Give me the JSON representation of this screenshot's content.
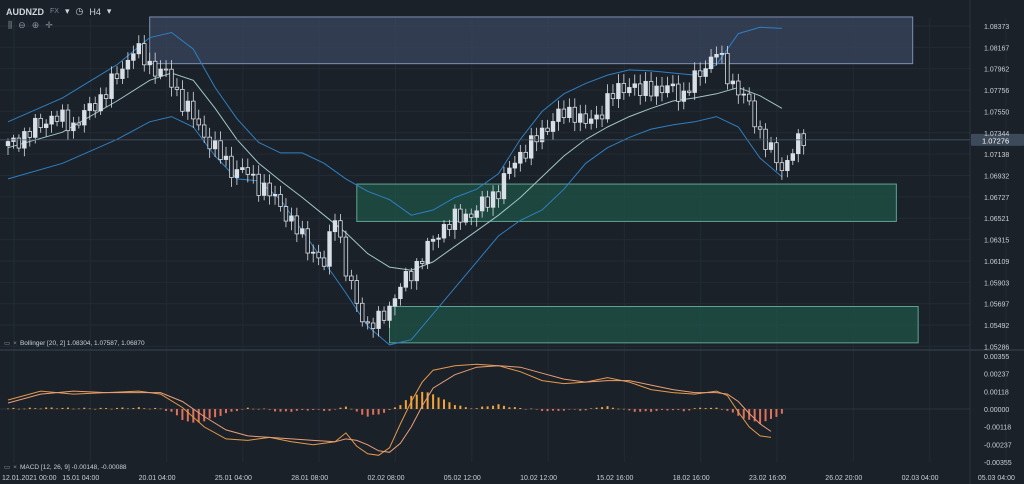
{
  "header": {
    "symbol": "AUDNZD",
    "symbol_type": "FX",
    "timeframe": "H4",
    "symbol_chevron_icon": "chevron-down-icon",
    "clock_icon": "clock-icon",
    "timeframe_chevron_icon": "chevron-down-icon"
  },
  "tools": [
    "bar-chart-icon",
    "zoom-out-icon",
    "zoom-in-icon",
    "crosshair-icon"
  ],
  "indicators": {
    "bollinger_label": "Bollinger [20, 2] 1.08304, 1.07587, 1.06870",
    "macd_label": "MACD [12, 26, 9] -0.00148, -0.00088"
  },
  "colors": {
    "background": "#1b2129",
    "bollinger_band": "#2f7fc1",
    "middle_band": "#9fc6c6",
    "candle_up": "#d9dfe6",
    "candle_down": "#d9dfe6",
    "supply_zone": "#3d4c66",
    "demand_zone": "#1f5a4c",
    "histogram_pos": "#f2a33a",
    "histogram_neg": "#e0705a",
    "macd_line": "#e49a4a",
    "signal_line": "#e89e78",
    "price_marker": "#3c4a5a"
  },
  "chart_data": [
    {
      "type": "candlestick",
      "symbol": "AUDNZD",
      "timeframe": "H4",
      "ylim": [
        1.0528,
        1.0845
      ],
      "y_ticks": [
        "1.08373",
        "1.08167",
        "1.07962",
        "1.07756",
        "1.07550",
        "1.07344",
        "1.07138",
        "1.06932",
        "1.06727",
        "1.06521",
        "1.06315",
        "1.06109",
        "1.05903",
        "1.05697",
        "1.05492",
        "1.05286"
      ],
      "current_price": "1.07276",
      "x_ticks": [
        "12.01.2021 00:00",
        "15.01 04:00",
        "20.01 04:00",
        "25.01 04:00",
        "28.01 08:00",
        "02.02 08:00",
        "05.02 12:00",
        "10.02 12:00",
        "15.02 16:00",
        "18.02 16:00",
        "23.02 16:00",
        "26.02 20:00",
        "02.03 04:00",
        "05.03 04:00"
      ],
      "close_path": [
        [
          0,
          1.0722
        ],
        [
          4,
          1.0735
        ],
        [
          8,
          1.075
        ],
        [
          12,
          1.0742
        ],
        [
          16,
          1.0762
        ],
        [
          20,
          1.0788
        ],
        [
          23,
          1.0815
        ],
        [
          26,
          1.08
        ],
        [
          29,
          1.079
        ],
        [
          32,
          1.0765
        ],
        [
          35,
          1.074
        ],
        [
          38,
          1.0718
        ],
        [
          41,
          1.07
        ],
        [
          44,
          1.0695
        ],
        [
          47,
          1.068
        ],
        [
          50,
          1.0665
        ],
        [
          53,
          1.064
        ],
        [
          56,
          1.062
        ],
        [
          58,
          1.0605
        ],
        [
          60,
          1.066
        ],
        [
          62,
          1.06
        ],
        [
          64,
          1.057
        ],
        [
          66,
          1.0548
        ],
        [
          68,
          1.0552
        ],
        [
          70,
          1.0568
        ],
        [
          72,
          1.0585
        ],
        [
          74,
          1.06
        ],
        [
          76,
          1.0615
        ],
        [
          78,
          1.063
        ],
        [
          80,
          1.0645
        ],
        [
          82,
          1.065
        ],
        [
          84,
          1.0655
        ],
        [
          86,
          1.066
        ],
        [
          88,
          1.0668
        ],
        [
          90,
          1.068
        ],
        [
          92,
          1.0698
        ],
        [
          94,
          1.0715
        ],
        [
          96,
          1.0722
        ],
        [
          98,
          1.0735
        ],
        [
          100,
          1.0748
        ],
        [
          102,
          1.0752
        ],
        [
          104,
          1.0755
        ],
        [
          106,
          1.0742
        ],
        [
          108,
          1.075
        ],
        [
          110,
          1.0765
        ],
        [
          112,
          1.0775
        ],
        [
          114,
          1.0782
        ],
        [
          116,
          1.0772
        ],
        [
          118,
          1.078
        ],
        [
          120,
          1.0774
        ],
        [
          122,
          1.0778
        ],
        [
          124,
          1.077
        ],
        [
          126,
          1.0785
        ],
        [
          128,
          1.08
        ],
        [
          130,
          1.0812
        ],
        [
          132,
          1.079
        ],
        [
          134,
          1.0775
        ],
        [
          136,
          1.076
        ],
        [
          138,
          1.0735
        ],
        [
          140,
          1.0715
        ],
        [
          142,
          1.07
        ],
        [
          144,
          1.0718
        ],
        [
          146,
          1.0728
        ]
      ],
      "bollinger": {
        "upper": [
          [
            0,
            1.0745
          ],
          [
            10,
            1.0768
          ],
          [
            20,
            1.08
          ],
          [
            26,
            1.0826
          ],
          [
            30,
            1.0831
          ],
          [
            34,
            1.0815
          ],
          [
            38,
            1.0778
          ],
          [
            42,
            1.0748
          ],
          [
            46,
            1.0725
          ],
          [
            50,
            1.0715
          ],
          [
            54,
            1.0715
          ],
          [
            58,
            1.0705
          ],
          [
            62,
            1.069
          ],
          [
            66,
            1.0678
          ],
          [
            70,
            1.067
          ],
          [
            74,
            1.0655
          ],
          [
            78,
            1.066
          ],
          [
            82,
            1.0672
          ],
          [
            86,
            1.068
          ],
          [
            90,
            1.0695
          ],
          [
            94,
            1.0728
          ],
          [
            98,
            1.0755
          ],
          [
            102,
            1.0772
          ],
          [
            106,
            1.0782
          ],
          [
            110,
            1.079
          ],
          [
            114,
            1.0795
          ],
          [
            118,
            1.0794
          ],
          [
            122,
            1.0792
          ],
          [
            126,
            1.079
          ],
          [
            130,
            1.08
          ],
          [
            134,
            1.083
          ],
          [
            138,
            1.0836
          ],
          [
            142,
            1.0835
          ]
        ],
        "middle": [
          [
            0,
            1.072
          ],
          [
            10,
            1.0735
          ],
          [
            20,
            1.0765
          ],
          [
            26,
            1.0785
          ],
          [
            30,
            1.0792
          ],
          [
            34,
            1.0785
          ],
          [
            38,
            1.0758
          ],
          [
            42,
            1.0728
          ],
          [
            46,
            1.0705
          ],
          [
            50,
            1.0688
          ],
          [
            54,
            1.0672
          ],
          [
            58,
            1.0655
          ],
          [
            62,
            1.0638
          ],
          [
            66,
            1.0618
          ],
          [
            70,
            1.0605
          ],
          [
            74,
            1.0602
          ],
          [
            78,
            1.061
          ],
          [
            82,
            1.0625
          ],
          [
            86,
            1.064
          ],
          [
            90,
            1.0655
          ],
          [
            94,
            1.0672
          ],
          [
            98,
            1.0692
          ],
          [
            102,
            1.0712
          ],
          [
            106,
            1.0728
          ],
          [
            110,
            1.074
          ],
          [
            114,
            1.075
          ],
          [
            118,
            1.0758
          ],
          [
            122,
            1.0765
          ],
          [
            126,
            1.0768
          ],
          [
            130,
            1.0772
          ],
          [
            134,
            1.0778
          ],
          [
            138,
            1.077
          ],
          [
            142,
            1.0758
          ]
        ],
        "lower": [
          [
            0,
            1.069
          ],
          [
            10,
            1.0705
          ],
          [
            20,
            1.0728
          ],
          [
            26,
            1.0745
          ],
          [
            30,
            1.075
          ],
          [
            34,
            1.074
          ],
          [
            38,
            1.0712
          ],
          [
            42,
            1.069
          ],
          [
            46,
            1.0688
          ],
          [
            50,
            1.067
          ],
          [
            54,
            1.064
          ],
          [
            58,
            1.061
          ],
          [
            62,
            1.058
          ],
          [
            66,
            1.0548
          ],
          [
            70,
            1.053
          ],
          [
            74,
            1.0535
          ],
          [
            78,
            1.056
          ],
          [
            82,
            1.0585
          ],
          [
            86,
            1.061
          ],
          [
            90,
            1.0635
          ],
          [
            94,
            1.065
          ],
          [
            98,
            1.066
          ],
          [
            102,
            1.068
          ],
          [
            106,
            1.0705
          ],
          [
            110,
            1.072
          ],
          [
            114,
            1.073
          ],
          [
            118,
            1.0738
          ],
          [
            122,
            1.0742
          ],
          [
            126,
            1.0745
          ],
          [
            130,
            1.075
          ],
          [
            134,
            1.074
          ],
          [
            138,
            1.071
          ],
          [
            142,
            1.0692
          ]
        ]
      },
      "zones": [
        {
          "kind": "supply",
          "x0": 26,
          "x1": 166,
          "y_high": 1.0846,
          "y_low": 1.0801
        },
        {
          "kind": "demand",
          "x0": 64,
          "x1": 163,
          "y_high": 1.0685,
          "y_low": 1.0649
        },
        {
          "kind": "demand",
          "x0": 70,
          "x1": 167,
          "y_high": 1.0567,
          "y_low": 1.0532
        }
      ]
    },
    {
      "type": "macd",
      "ylim": [
        -0.00355,
        0.00355
      ],
      "y_ticks": [
        "0.00355",
        "0.00237",
        "0.00118",
        "0.00000",
        "-0.00118",
        "-0.00237",
        "-0.00355"
      ],
      "histogram": [
        [
          0,
          3e-05
        ],
        [
          4,
          5e-05
        ],
        [
          8,
          8e-05
        ],
        [
          12,
          5e-05
        ],
        [
          16,
          4e-05
        ],
        [
          20,
          6e-05
        ],
        [
          24,
          8e-05
        ],
        [
          28,
          2e-05
        ],
        [
          30,
          -0.0002
        ],
        [
          32,
          -0.0007
        ],
        [
          34,
          -0.00095
        ],
        [
          36,
          -0.0008
        ],
        [
          38,
          -0.00055
        ],
        [
          40,
          -0.0003
        ],
        [
          42,
          -0.0001
        ],
        [
          44,
          5e-05
        ],
        [
          46,
          3e-05
        ],
        [
          48,
          -5e-05
        ],
        [
          50,
          -0.0002
        ],
        [
          52,
          -0.00015
        ],
        [
          54,
          -0.0001
        ],
        [
          56,
          -5e-05
        ],
        [
          58,
          -0.00012
        ],
        [
          60,
          -5e-05
        ],
        [
          62,
          0.0002
        ],
        [
          64,
          -0.0002
        ],
        [
          66,
          -0.0005
        ],
        [
          68,
          -0.00035
        ],
        [
          70,
          -0.0001
        ],
        [
          72,
          0.0003
        ],
        [
          74,
          0.00085
        ],
        [
          76,
          0.00115
        ],
        [
          78,
          0.001
        ],
        [
          80,
          0.0006
        ],
        [
          82,
          0.0003
        ],
        [
          84,
          0.0001
        ],
        [
          86,
          5e-05
        ],
        [
          88,
          0.0002
        ],
        [
          90,
          0.00028
        ],
        [
          92,
          0.00015
        ],
        [
          94,
          5e-05
        ],
        [
          96,
          2e-05
        ],
        [
          98,
          -0.0001
        ],
        [
          100,
          -0.00015
        ],
        [
          102,
          -8e-05
        ],
        [
          104,
          -5e-05
        ],
        [
          106,
          -0.0001
        ],
        [
          108,
          0.00012
        ],
        [
          110,
          0.00015
        ],
        [
          112,
          5e-05
        ],
        [
          114,
          -0.0001
        ],
        [
          116,
          -0.0002
        ],
        [
          118,
          -0.00015
        ],
        [
          120,
          -0.0001
        ],
        [
          122,
          -5e-05
        ],
        [
          124,
          -0.00015
        ],
        [
          126,
          3e-05
        ],
        [
          128,
          0.0001
        ],
        [
          130,
          5e-05
        ],
        [
          132,
          -0.0001
        ],
        [
          134,
          -0.00045
        ],
        [
          136,
          -0.00075
        ],
        [
          138,
          -0.00095
        ],
        [
          140,
          -0.0007
        ],
        [
          142,
          -0.0003
        ]
      ],
      "macd_line": [
        [
          0,
          0.0006
        ],
        [
          6,
          0.0012
        ],
        [
          12,
          0.001
        ],
        [
          18,
          0.0011
        ],
        [
          24,
          0.0012
        ],
        [
          28,
          0.001
        ],
        [
          32,
          0.0001
        ],
        [
          36,
          -0.0012
        ],
        [
          40,
          -0.002
        ],
        [
          44,
          -0.0021
        ],
        [
          48,
          -0.0019
        ],
        [
          52,
          -0.0022
        ],
        [
          56,
          -0.0024
        ],
        [
          60,
          -0.0022
        ],
        [
          62,
          -0.0016
        ],
        [
          64,
          -0.0025
        ],
        [
          66,
          -0.003
        ],
        [
          68,
          -0.0031
        ],
        [
          70,
          -0.0026
        ],
        [
          72,
          -0.001
        ],
        [
          74,
          0.0005
        ],
        [
          76,
          0.0018
        ],
        [
          78,
          0.0026
        ],
        [
          82,
          0.0029
        ],
        [
          86,
          0.003
        ],
        [
          90,
          0.0029
        ],
        [
          94,
          0.0025
        ],
        [
          98,
          0.0019
        ],
        [
          102,
          0.0017
        ],
        [
          106,
          0.0018
        ],
        [
          110,
          0.0021
        ],
        [
          114,
          0.0018
        ],
        [
          118,
          0.0013
        ],
        [
          122,
          0.0011
        ],
        [
          126,
          0.001
        ],
        [
          130,
          0.0012
        ],
        [
          132,
          0.0009
        ],
        [
          134,
          -0.0002
        ],
        [
          136,
          -0.0012
        ],
        [
          138,
          -0.0018
        ],
        [
          140,
          -0.0019
        ]
      ],
      "signal_line": [
        [
          0,
          0.0004
        ],
        [
          6,
          0.001
        ],
        [
          12,
          0.0012
        ],
        [
          18,
          0.0011
        ],
        [
          24,
          0.0011
        ],
        [
          28,
          0.0011
        ],
        [
          32,
          0.0005
        ],
        [
          36,
          -0.0005
        ],
        [
          40,
          -0.0014
        ],
        [
          44,
          -0.0018
        ],
        [
          48,
          -0.0019
        ],
        [
          52,
          -0.002
        ],
        [
          56,
          -0.0021
        ],
        [
          60,
          -0.0022
        ],
        [
          62,
          -0.002
        ],
        [
          64,
          -0.0021
        ],
        [
          66,
          -0.0024
        ],
        [
          68,
          -0.0028
        ],
        [
          70,
          -0.0029
        ],
        [
          72,
          -0.0023
        ],
        [
          74,
          -0.0012
        ],
        [
          76,
          0.0002
        ],
        [
          78,
          0.0014
        ],
        [
          82,
          0.0023
        ],
        [
          86,
          0.0028
        ],
        [
          90,
          0.0029
        ],
        [
          94,
          0.0028
        ],
        [
          98,
          0.0024
        ],
        [
          102,
          0.002
        ],
        [
          106,
          0.0018
        ],
        [
          110,
          0.0019
        ],
        [
          114,
          0.0019
        ],
        [
          118,
          0.0016
        ],
        [
          122,
          0.0013
        ],
        [
          126,
          0.0011
        ],
        [
          130,
          0.0011
        ],
        [
          132,
          0.001
        ],
        [
          134,
          0.0005
        ],
        [
          136,
          -0.0003
        ],
        [
          138,
          -0.001
        ],
        [
          140,
          -0.0015
        ]
      ]
    }
  ]
}
